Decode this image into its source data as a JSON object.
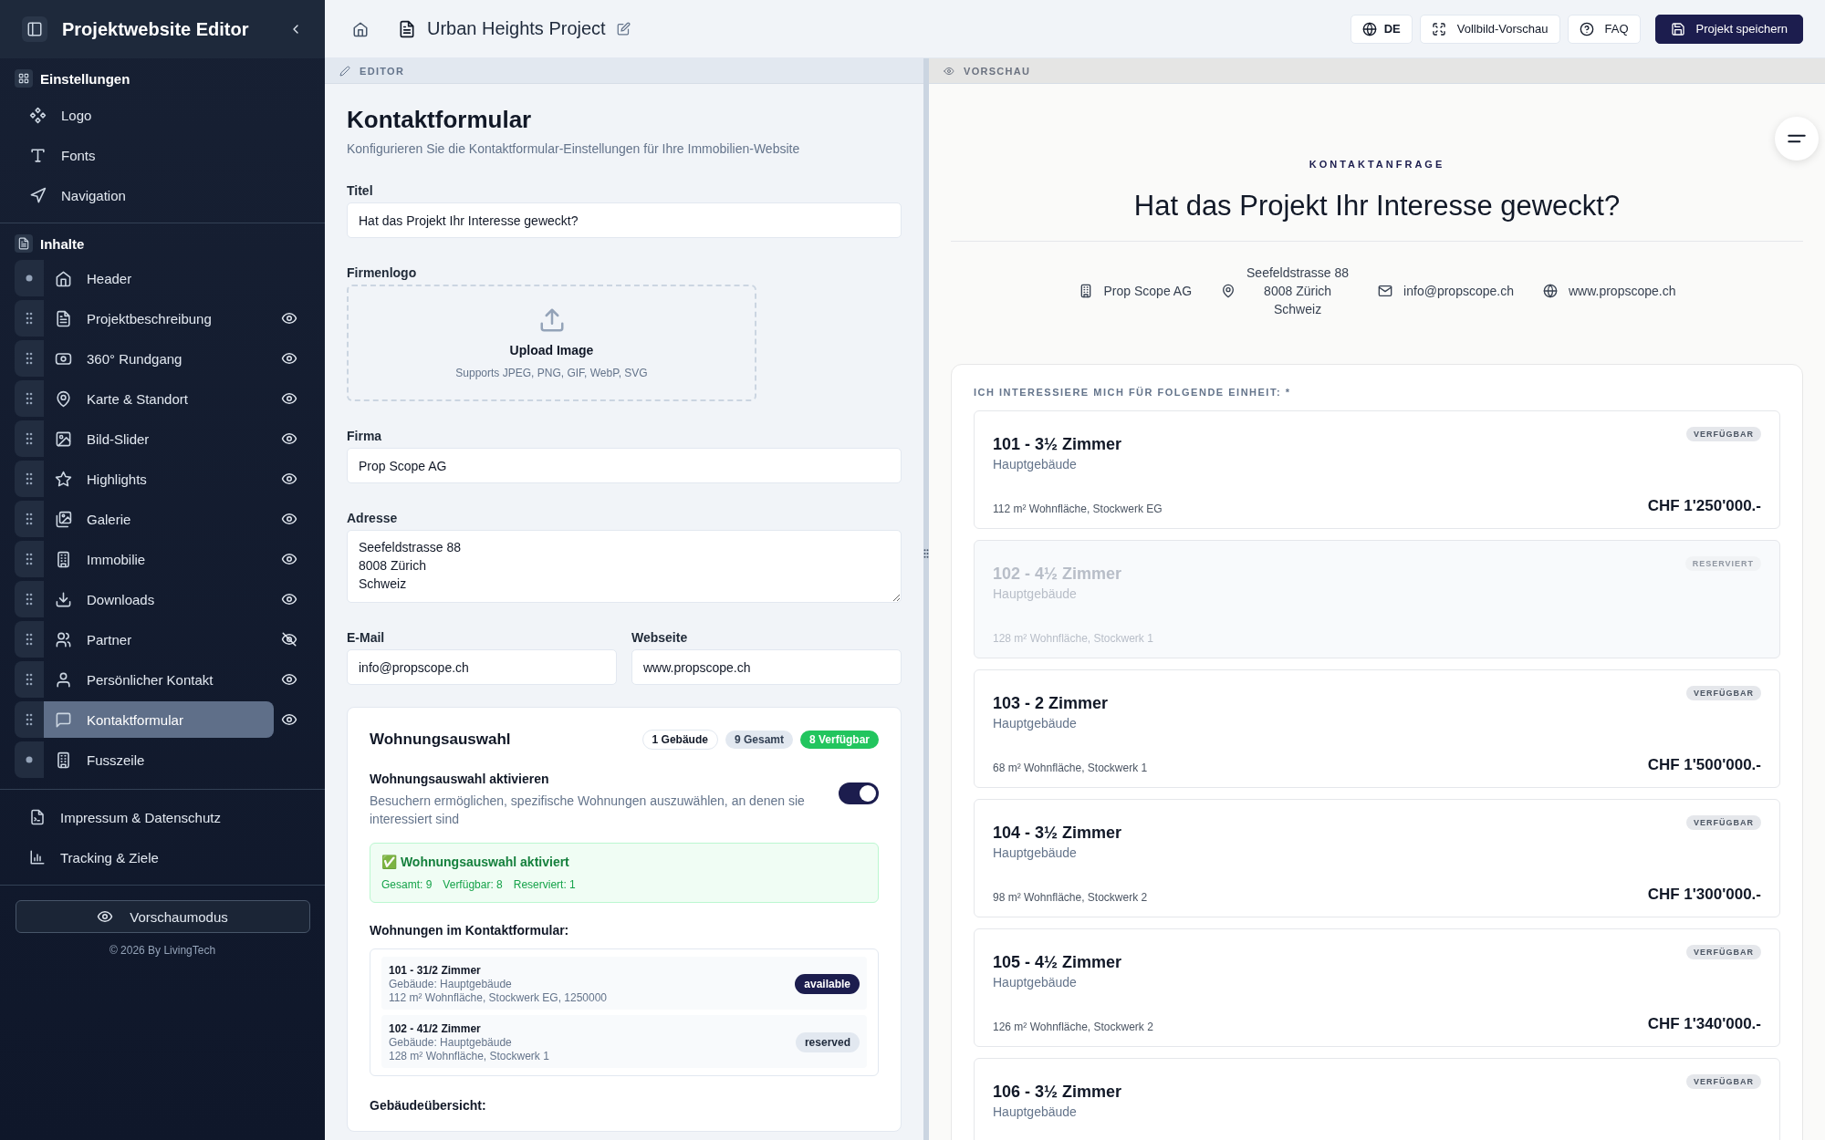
{
  "sidebar": {
    "title": "Projektwebsite Editor",
    "settings": {
      "label": "Einstellungen",
      "items": [
        {
          "label": "Logo"
        },
        {
          "label": "Fonts"
        },
        {
          "label": "Navigation"
        }
      ]
    },
    "contents": {
      "label": "Inhalte",
      "items": [
        {
          "label": "Header",
          "kind": "fixed",
          "selected": false
        },
        {
          "label": "Projektbeschreibung",
          "kind": "movable",
          "visible": true,
          "selected": false
        },
        {
          "label": "360° Rundgang",
          "kind": "movable",
          "visible": true,
          "selected": false
        },
        {
          "label": "Karte & Standort",
          "kind": "movable",
          "visible": true,
          "selected": false
        },
        {
          "label": "Bild-Slider",
          "kind": "movable",
          "visible": true,
          "selected": false
        },
        {
          "label": "Highlights",
          "kind": "movable",
          "visible": true,
          "selected": false
        },
        {
          "label": "Galerie",
          "kind": "movable",
          "visible": true,
          "selected": false
        },
        {
          "label": "Immobilie",
          "kind": "movable",
          "visible": true,
          "selected": false
        },
        {
          "label": "Downloads",
          "kind": "movable",
          "visible": true,
          "selected": false
        },
        {
          "label": "Partner",
          "kind": "movable",
          "visible": false,
          "selected": false
        },
        {
          "label": "Persönlicher Kontakt",
          "kind": "movable",
          "visible": true,
          "selected": false
        },
        {
          "label": "Kontaktformular",
          "kind": "movable",
          "visible": true,
          "selected": true
        },
        {
          "label": "Fusszeile",
          "kind": "fixed",
          "selected": false
        }
      ]
    },
    "links": [
      {
        "label": "Impressum & Datenschutz"
      },
      {
        "label": "Tracking & Ziele"
      }
    ],
    "preview_button": "Vorschaumodus",
    "footer": "© 2026 By LivingTech"
  },
  "topbar": {
    "project_title": "Urban Heights Project",
    "buttons": [
      {
        "label": "DE",
        "kind": "language"
      },
      {
        "label": "Vollbild-Vorschau",
        "kind": "fullscreen"
      },
      {
        "label": "FAQ",
        "kind": "help"
      },
      {
        "label": "Projekt speichern",
        "kind": "save"
      }
    ]
  },
  "editor": {
    "label": "EDITOR",
    "heading": "Kontaktformular",
    "subtitle": "Konfigurieren Sie die Kontaktformular-Einstellungen für Ihre Immobilien-Website",
    "fields": [
      {
        "label": "Titel",
        "kind": "text",
        "value": "Hat das Projekt Ihr Interesse geweckt?"
      },
      {
        "label": "Firmenlogo",
        "kind": "upload",
        "title": "Upload Image",
        "hint": "Supports JPEG, PNG, GIF, WebP, SVG"
      },
      {
        "label": "Firma",
        "kind": "text",
        "value": "Prop Scope AG"
      },
      {
        "label": "Adresse",
        "kind": "textarea",
        "value": "Seefeldstrasse 88\n8008 Zürich\nSchweiz"
      },
      {
        "label": "E-Mail",
        "kind": "half",
        "value": "info@propscope.ch"
      },
      {
        "label": "Webseite",
        "kind": "half",
        "value": "www.propscope.ch"
      }
    ],
    "selection": {
      "title": "Wohnungsauswahl",
      "badges": [
        {
          "label": "1 Gebäude",
          "kind": "outline"
        },
        {
          "label": "9 Gesamt",
          "kind": "muted"
        },
        {
          "label": "8 Verfügbar",
          "kind": "success"
        }
      ],
      "toggle": {
        "label": "Wohnungsauswahl aktivieren",
        "description": "Besuchern ermöglichen, spezifische Wohnungen auszuwählen, an denen sie interessiert sind",
        "on": true
      },
      "notice": {
        "title": "✅ Wohnungsauswahl aktiviert",
        "stats": [
          "Gesamt: 9",
          "Verfügbar: 8",
          "Reserviert: 1"
        ]
      },
      "units_heading": "Wohnungen im Kontaktformular:",
      "units": [
        {
          "title": "101 - 31/2 Zimmer",
          "building": "Gebäude: Hauptgebäude",
          "details": "112 m² Wohnfläche, Stockwerk EG, 1250000",
          "status": "available",
          "kind": "available"
        },
        {
          "title": "102 - 41/2 Zimmer",
          "building": "Gebäude: Hauptgebäude",
          "details": "128 m² Wohnfläche, Stockwerk 1",
          "status": "reserved",
          "kind": "reserved"
        }
      ],
      "overview_heading": "Gebäudeübersicht:"
    }
  },
  "preview": {
    "label": "VORSCHAU",
    "eyebrow": "KONTAKTANFRAGE",
    "title": "Hat das Projekt Ihr Interesse geweckt?",
    "contacts": [
      {
        "kind": "company",
        "text": "Prop Scope AG"
      },
      {
        "kind": "address",
        "text": "Seefeldstrasse 88\n8008 Zürich\nSchweiz"
      },
      {
        "kind": "email",
        "text": "info@propscope.ch"
      },
      {
        "kind": "website",
        "text": "www.propscope.ch"
      }
    ],
    "units_label": "ICH INTERESSIERE MICH FÜR FOLGENDE EINHEIT: *",
    "units": [
      {
        "title": "101 - 3½ Zimmer",
        "building": "Hauptgebäude",
        "details": "112 m² Wohnfläche, Stockwerk EG",
        "price": "CHF 1'250'000.-",
        "status": "VERFÜGBAR",
        "reserved": false
      },
      {
        "title": "102 - 4½ Zimmer",
        "building": "Hauptgebäude",
        "details": "128 m² Wohnfläche, Stockwerk 1",
        "status": "RESERVIERT",
        "reserved": true
      },
      {
        "title": "103 - 2 Zimmer",
        "building": "Hauptgebäude",
        "details": "68 m² Wohnfläche, Stockwerk 1",
        "price": "CHF 1'500'000.-",
        "status": "VERFÜGBAR",
        "reserved": false
      },
      {
        "title": "104 - 3½ Zimmer",
        "building": "Hauptgebäude",
        "details": "98 m² Wohnfläche, Stockwerk 2",
        "price": "CHF 1'300'000.-",
        "status": "VERFÜGBAR",
        "reserved": false
      },
      {
        "title": "105 - 4½ Zimmer",
        "building": "Hauptgebäude",
        "details": "126 m² Wohnfläche, Stockwerk 2",
        "price": "CHF 1'340'000.-",
        "status": "VERFÜGBAR",
        "reserved": false
      },
      {
        "title": "106 - 3½ Zimmer",
        "building": "Hauptgebäude",
        "status": "VERFÜGBAR",
        "reserved": false
      }
    ]
  }
}
